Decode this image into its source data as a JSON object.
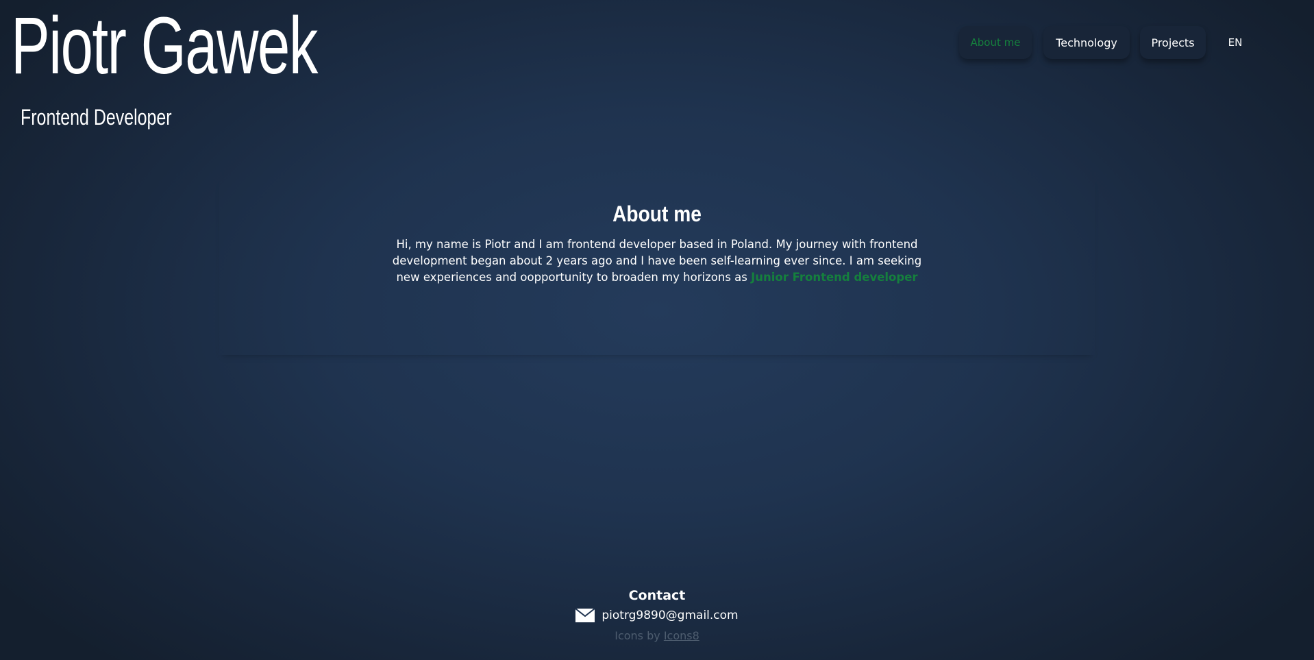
{
  "header": {
    "name": "Piotr Gawek",
    "role": "Frontend Developer"
  },
  "nav": {
    "items": [
      {
        "label": "About me",
        "active": true
      },
      {
        "label": "Technology",
        "active": false
      },
      {
        "label": "Projects",
        "active": false
      }
    ],
    "language": "EN"
  },
  "about": {
    "title": "About me",
    "text": "Hi, my name is Piotr and I am frontend developer based in Poland. My journey with frontend development began about 2 years ago and I have been self-learning ever since. I am seeking new experiences and oopportunity to broaden my horizons as",
    "highlight": "Junior Frontend developer"
  },
  "contact": {
    "title": "Contact",
    "email": "piotrg9890@gmail.com",
    "email_icon": "mail-icon",
    "credit_prefix": "Icons by",
    "credit_link": "Icons8"
  },
  "colors": {
    "accent": "#15803d",
    "background_center": "#243b5b",
    "background_edge": "#141f2e",
    "nav_button": "#182538",
    "muted_text": "#4e5d6f"
  }
}
